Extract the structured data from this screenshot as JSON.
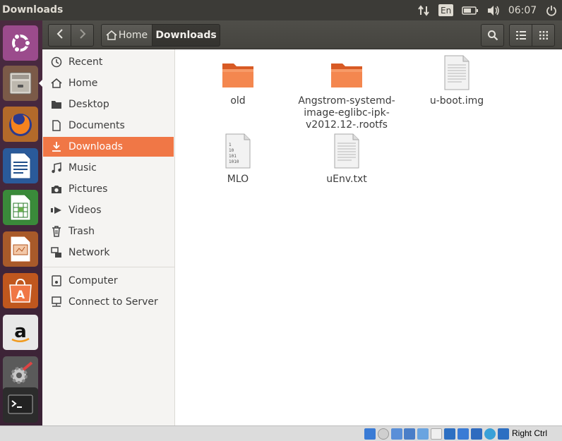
{
  "window": {
    "title": "Downloads"
  },
  "tray": {
    "language": "En",
    "time": "06:07"
  },
  "toolbar": {
    "home_label": "Home",
    "current_label": "Downloads"
  },
  "sidebar": {
    "items": [
      {
        "label": "Recent",
        "icon": "clock-icon"
      },
      {
        "label": "Home",
        "icon": "home-icon"
      },
      {
        "label": "Desktop",
        "icon": "folder-icon"
      },
      {
        "label": "Documents",
        "icon": "document-icon"
      },
      {
        "label": "Downloads",
        "icon": "download-icon",
        "active": true
      },
      {
        "label": "Music",
        "icon": "music-icon"
      },
      {
        "label": "Pictures",
        "icon": "camera-icon"
      },
      {
        "label": "Videos",
        "icon": "video-icon"
      },
      {
        "label": "Trash",
        "icon": "trash-icon"
      },
      {
        "label": "Network",
        "icon": "network-icon"
      },
      {
        "label": "Computer",
        "icon": "computer-icon"
      },
      {
        "label": "Connect to Server",
        "icon": "server-icon"
      }
    ]
  },
  "files": [
    {
      "name": "old",
      "type": "folder"
    },
    {
      "name": "Angstrom-systemd-image-eglibc-ipk-v2012.12-.rootfs",
      "type": "folder"
    },
    {
      "name": "u-boot.img",
      "type": "text-file"
    },
    {
      "name": "MLO",
      "type": "binary-file"
    },
    {
      "name": "uEnv.txt",
      "type": "text-file"
    }
  ],
  "statusbar": {
    "host_key": "Right Ctrl"
  },
  "colors": {
    "accent": "#f07746",
    "panel": "#3c3b37",
    "launcher": "#4a2a40",
    "folder": "#f07746"
  }
}
